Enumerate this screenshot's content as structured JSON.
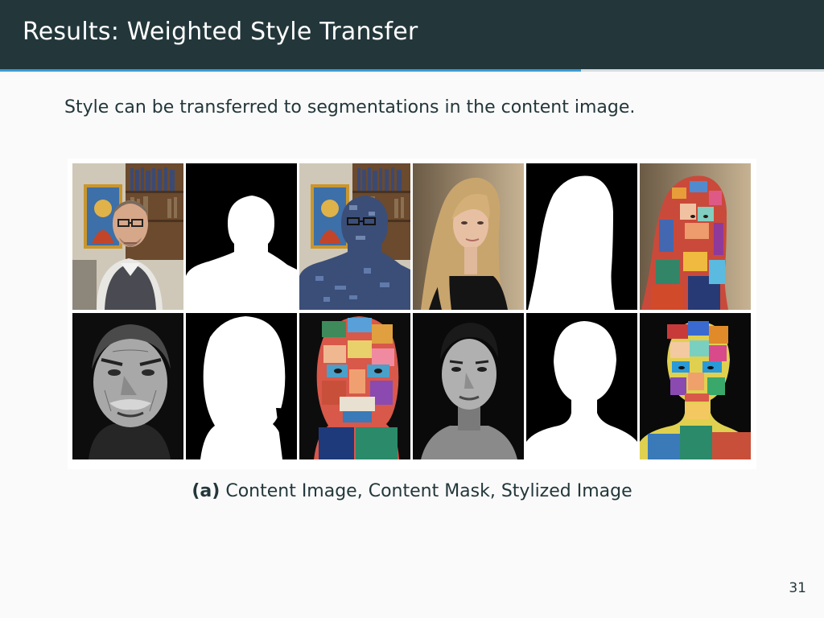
{
  "slide": {
    "title": "Results: Weighted Style Transfer",
    "subtitle": "Style can be transferred to segmentations in the content image.",
    "progress": 0.705,
    "page_number": "31"
  },
  "figure": {
    "caption_label": "(a)",
    "caption_text": "Content Image, Content Mask, Stylized Image",
    "rows": [
      [
        {
          "kind": "content-image",
          "subject": "man with glasses in office"
        },
        {
          "kind": "content-mask",
          "subject": "man silhouette"
        },
        {
          "kind": "stylized-image",
          "subject": "man with glasses in office"
        },
        {
          "kind": "content-image",
          "subject": "woman with long blonde hair"
        },
        {
          "kind": "content-mask",
          "subject": "woman silhouette"
        },
        {
          "kind": "stylized-image",
          "subject": "woman with long hair"
        }
      ],
      [
        {
          "kind": "content-image",
          "subject": "older man with mustache"
        },
        {
          "kind": "content-mask",
          "subject": "older man silhouette"
        },
        {
          "kind": "stylized-image",
          "subject": "older man with mustache"
        },
        {
          "kind": "content-image",
          "subject": "young man portrait"
        },
        {
          "kind": "content-mask",
          "subject": "young man silhouette"
        },
        {
          "kind": "stylized-image",
          "subject": "young man portrait"
        }
      ]
    ]
  }
}
